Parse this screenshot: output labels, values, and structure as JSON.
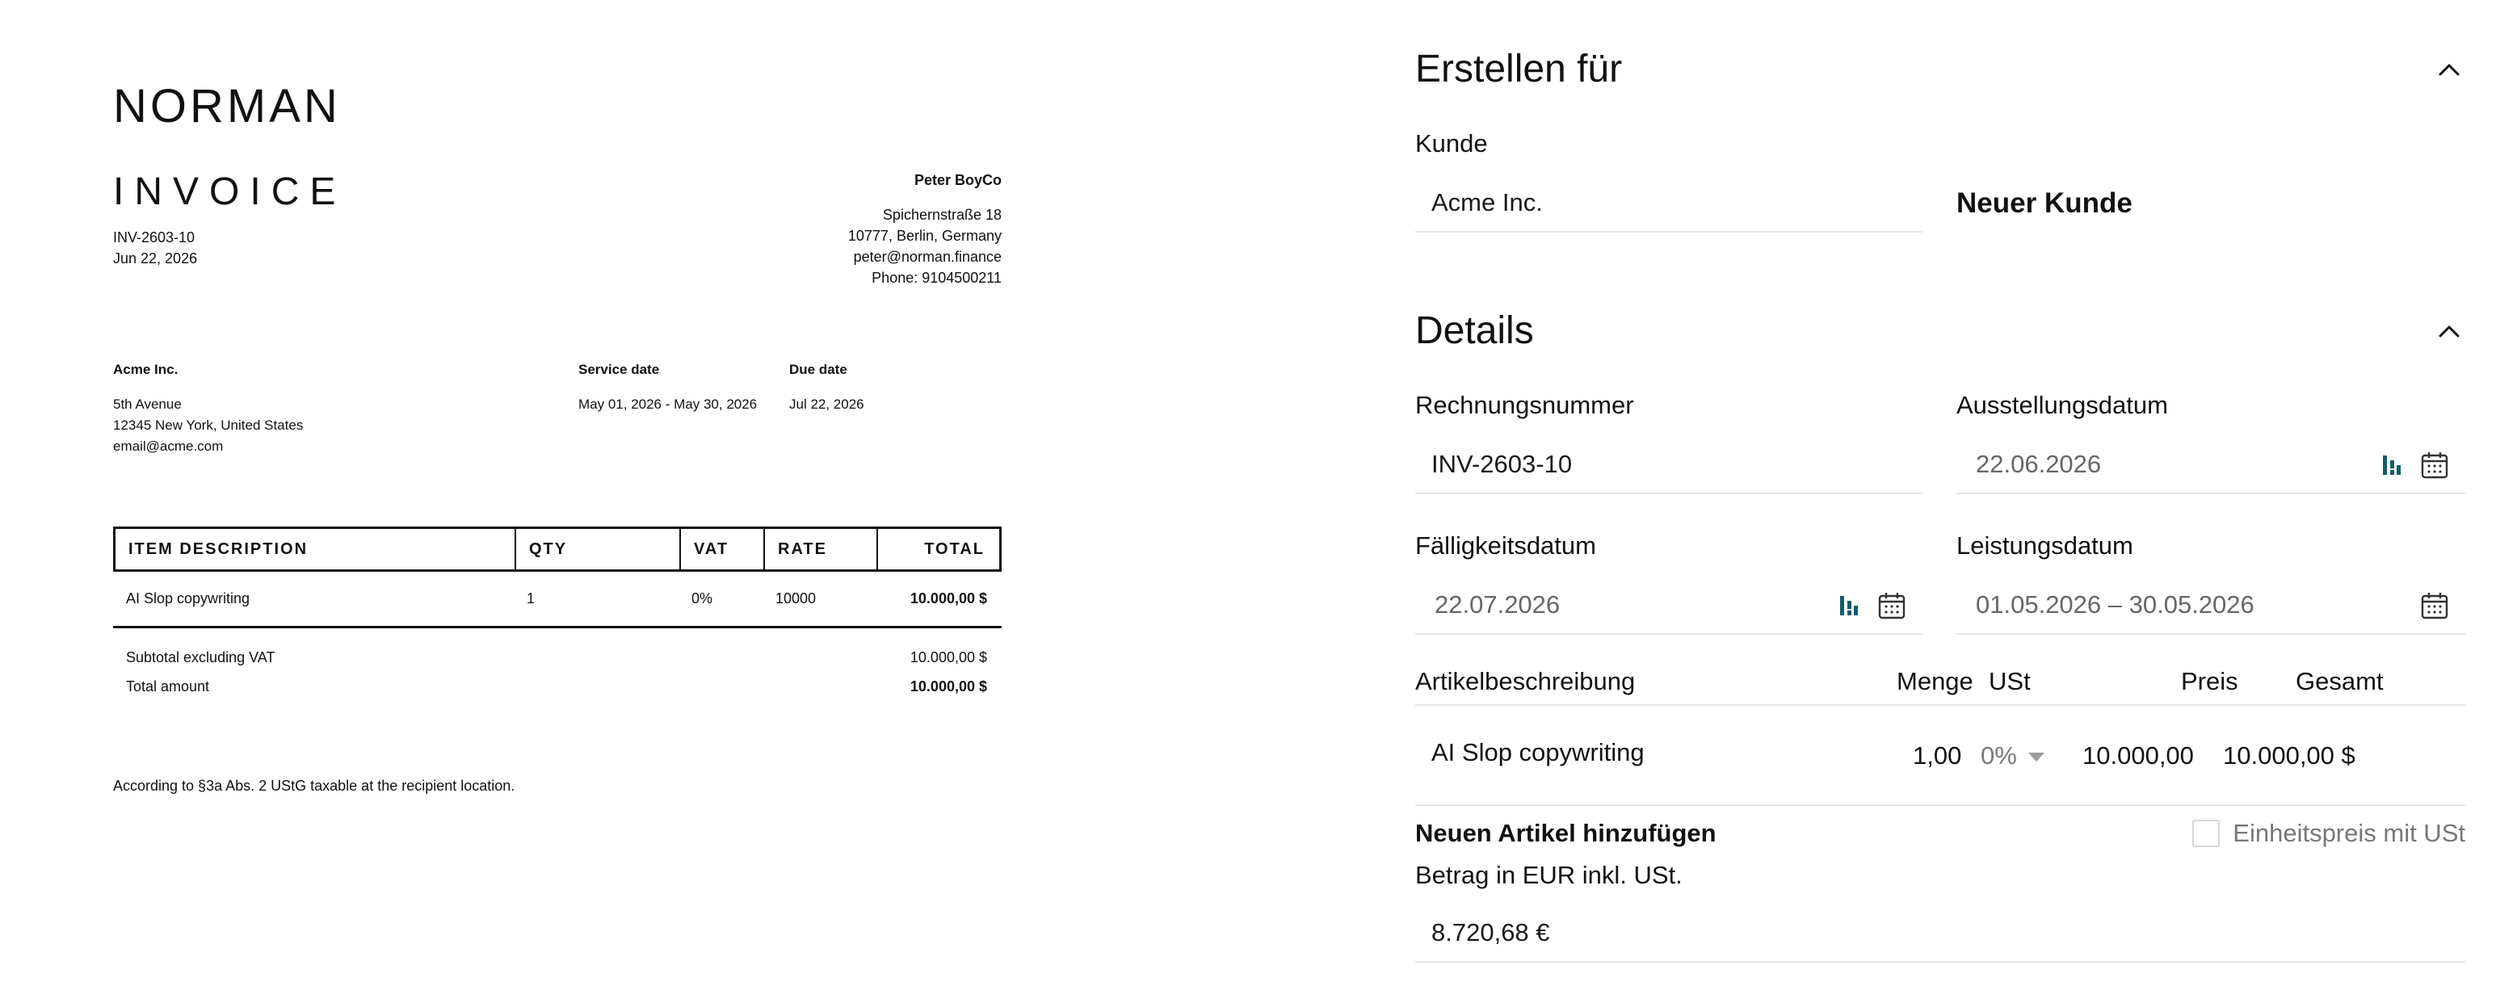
{
  "invoice_preview": {
    "logo": "NORMAN",
    "title": "INVOICE",
    "number": "INV-2603-10",
    "date": "Jun 22, 2026",
    "sender": {
      "name": "Peter BoyCo",
      "street": "Spichernstraße 18",
      "city": "10777, Berlin, Germany",
      "email": "peter@norman.finance",
      "phone": "Phone: 9104500211"
    },
    "recipient": {
      "name": "Acme Inc.",
      "street": "5th Avenue",
      "city": "12345 New York, United States",
      "email": "email@acme.com"
    },
    "service_date_label": "Service date",
    "service_date": "May 01, 2026 - May 30, 2026",
    "due_date_label": "Due date",
    "due_date": "Jul 22, 2026",
    "table": {
      "headers": [
        "ITEM DESCRIPTION",
        "QTY",
        "VAT",
        "RATE",
        "TOTAL"
      ],
      "rows": [
        [
          "AI Slop copywriting",
          "1",
          "0%",
          "10000",
          "10.000,00 $"
        ]
      ]
    },
    "subtotal_label": "Subtotal excluding VAT",
    "subtotal_value": "10.000,00 $",
    "total_label": "Total amount",
    "total_value": "10.000,00 $",
    "note": "According to §3a Abs. 2 UStG taxable at the recipient location."
  },
  "form": {
    "section_customer": {
      "title": "Erstellen für",
      "customer_label": "Kunde",
      "customer_value": "Acme Inc.",
      "new_customer": "Neuer Kunde"
    },
    "section_details": {
      "title": "Details",
      "invoice_number_label": "Rechnungsnummer",
      "invoice_number_value": "INV-2603-10",
      "issue_date_label": "Ausstellungsdatum",
      "issue_date_value": "22.06.2026",
      "due_date_label": "Fälligkeitsdatum",
      "due_date_value": "22.07.2026",
      "service_date_label": "Leistungsdatum",
      "service_date_value": "01.05.2026 – 30.05.2026"
    },
    "items": {
      "headers": {
        "description": "Artikelbeschreibung",
        "quantity": "Menge",
        "vat": "USt",
        "price": "Preis",
        "total": "Gesamt"
      },
      "rows": [
        {
          "description": "AI Slop copywriting",
          "quantity": "1,00",
          "vat": "0%",
          "price": "10.000,00",
          "total": "10.000,00 $"
        }
      ]
    },
    "add_item": "Neuen Artikel hinzufügen",
    "unit_price_with_vat": "Einheitspreis mit USt",
    "unit_price_with_vat_checked": false,
    "amount_label": "Betrag in EUR inkl. USt.",
    "amount_value": "8.720,68 €"
  },
  "icons": {
    "collapse": "chevron-up-icon",
    "calendar": "calendar-icon",
    "ai": "ai-date-icon"
  },
  "colors": {
    "text": "#111111",
    "muted": "#666666",
    "divider": "#e6e6e6",
    "accent_icon": "#0f5e6b"
  }
}
